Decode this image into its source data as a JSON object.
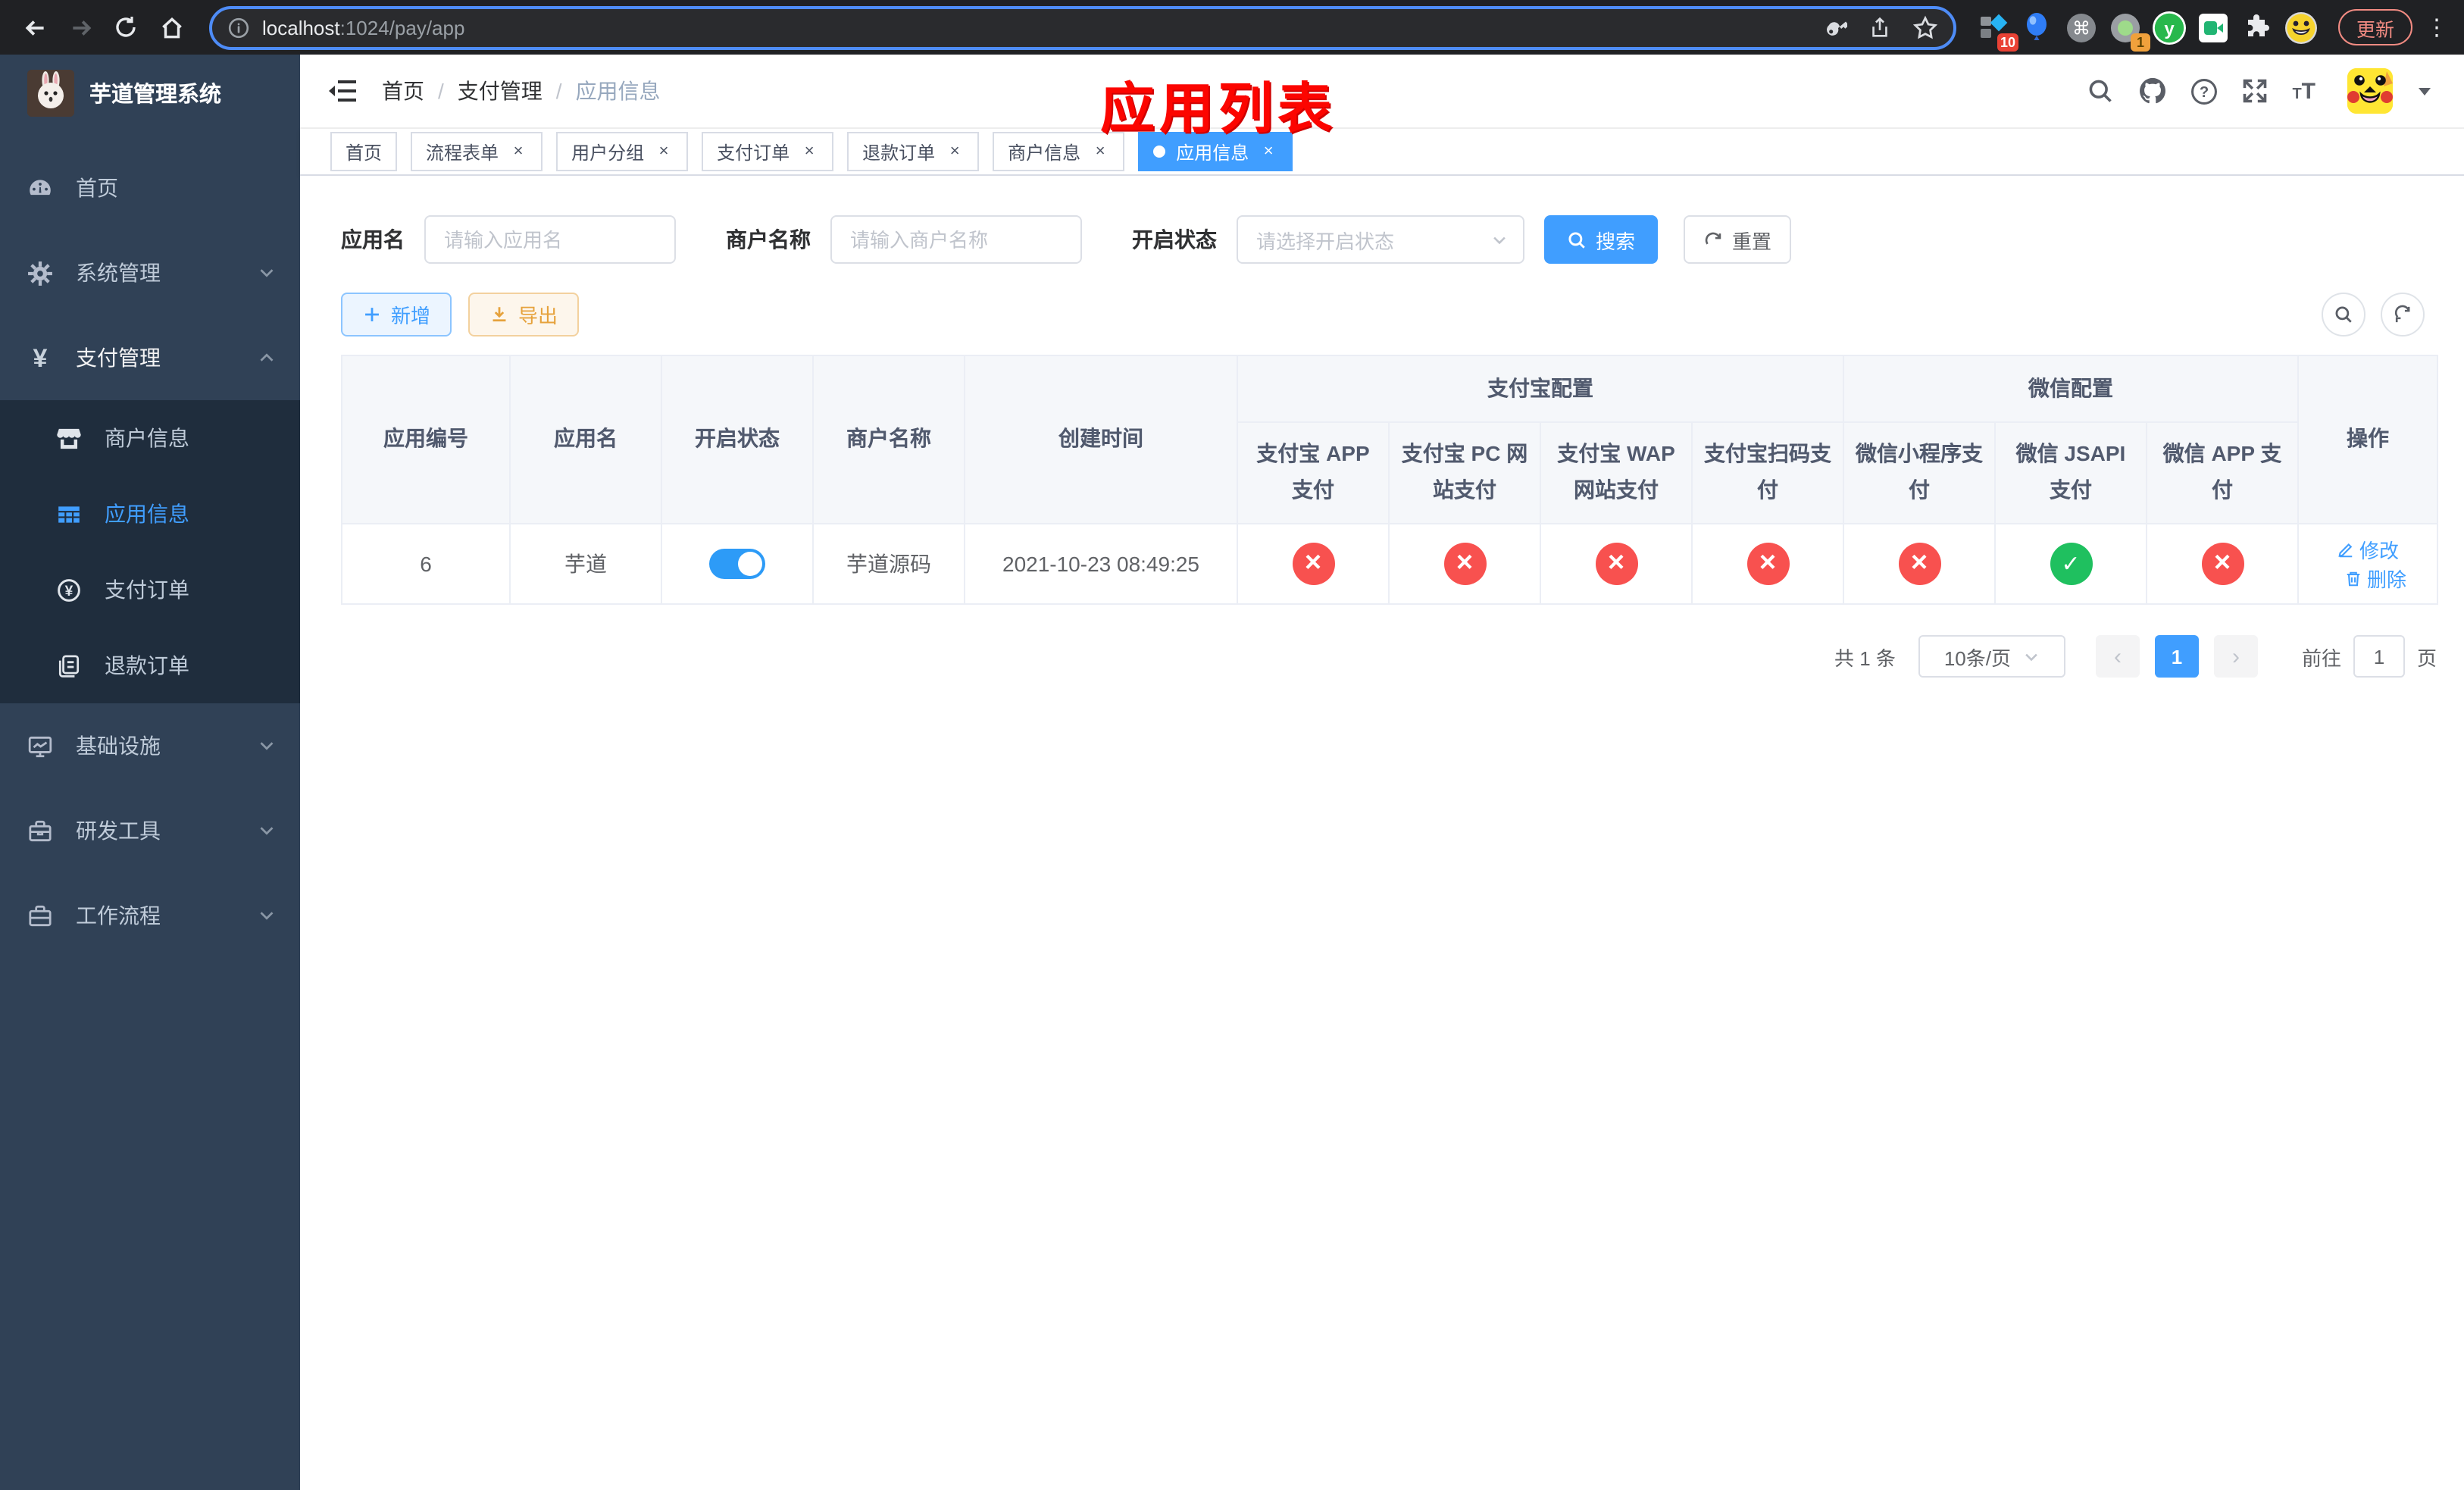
{
  "browser": {
    "url_host": "localhost",
    "url_rest": ":1024/pay/app",
    "update_label": "更新",
    "badge_pin": "10",
    "badge_proxy": "1"
  },
  "sidebar": {
    "title": "芋道管理系统",
    "menu": [
      {
        "label": "首页",
        "icon": "dashboard-icon"
      },
      {
        "label": "系统管理",
        "icon": "gear-icon"
      },
      {
        "label": "支付管理",
        "icon": "yen-icon",
        "expanded": true,
        "children": [
          {
            "label": "商户信息",
            "icon": "shop-icon"
          },
          {
            "label": "应用信息",
            "icon": "grid-icon",
            "active": true
          },
          {
            "label": "支付订单",
            "icon": "yen-circle-icon"
          },
          {
            "label": "退款订单",
            "icon": "documents-icon"
          }
        ]
      },
      {
        "label": "基础设施",
        "icon": "monitor-icon"
      },
      {
        "label": "研发工具",
        "icon": "toolbox-icon"
      },
      {
        "label": "工作流程",
        "icon": "briefcase-icon"
      }
    ]
  },
  "header": {
    "breadcrumb": [
      "首页",
      "支付管理",
      "应用信息"
    ],
    "annotation": "应用列表"
  },
  "tabs": [
    {
      "label": "首页",
      "closable": false,
      "active": false
    },
    {
      "label": "流程表单",
      "closable": true,
      "active": false
    },
    {
      "label": "用户分组",
      "closable": true,
      "active": false
    },
    {
      "label": "支付订单",
      "closable": true,
      "active": false
    },
    {
      "label": "退款订单",
      "closable": true,
      "active": false
    },
    {
      "label": "商户信息",
      "closable": true,
      "active": false
    },
    {
      "label": "应用信息",
      "closable": true,
      "active": true
    }
  ],
  "filters": {
    "app_name_label": "应用名",
    "app_name_placeholder": "请输入应用名",
    "merchant_label": "商户名称",
    "merchant_placeholder": "请输入商户名称",
    "status_label": "开启状态",
    "status_placeholder": "请选择开启状态",
    "search_label": "搜索",
    "reset_label": "重置"
  },
  "toolbar": {
    "add_label": "新增",
    "export_label": "导出"
  },
  "table": {
    "columns_left": [
      "应用编号",
      "应用名",
      "开启状态",
      "商户名称",
      "创建时间"
    ],
    "groups": [
      {
        "label": "支付宝配置",
        "children": [
          "支付宝 APP 支付",
          "支付宝 PC 网站支付",
          "支付宝 WAP 网站支付",
          "支付宝扫码支付"
        ]
      },
      {
        "label": "微信配置",
        "children": [
          "微信小程序支付",
          "微信 JSAPI 支付",
          "微信 APP 支付"
        ]
      }
    ],
    "op_column": "操作",
    "rows": [
      {
        "id": "6",
        "name": "芋道",
        "enabled": true,
        "merchant": "芋道源码",
        "created_at": "2021-10-23 08:49:25",
        "channel_enabled": [
          false,
          false,
          false,
          false,
          false,
          true,
          false
        ],
        "edit_label": "修改",
        "delete_label": "删除"
      }
    ]
  },
  "pagination": {
    "total": "共 1 条",
    "page_size": "10条/页",
    "page": "1",
    "goto_label": "前往",
    "goto_value": "1",
    "page_unit": "页"
  },
  "colors": {
    "primary": "#409eff",
    "success": "#1fc05f",
    "danger": "#f8514f",
    "warning": "#e6a23c",
    "annotation_red": "#fc0500",
    "sidebar_bg": "#304156",
    "submenu_bg": "#1f2d3d"
  }
}
